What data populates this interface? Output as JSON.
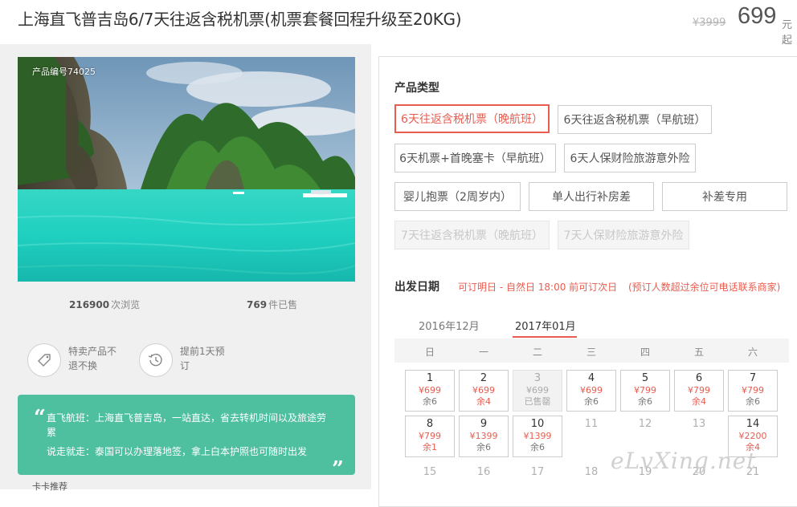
{
  "header": {
    "title": "上海直飞普吉岛6/7天往返含税机票(机票套餐回程升级至20KG)",
    "old_price": "¥3999",
    "price": "699",
    "price_unit": "元起"
  },
  "gallery": {
    "product_code": "产品编号74025"
  },
  "stats": {
    "views_count": "216900",
    "views_label": "次浏览",
    "sold_count": "769",
    "sold_label": "件已售"
  },
  "features": [
    {
      "icon": "tag-icon",
      "text": "特卖产品不退不换"
    },
    {
      "icon": "clock-history-icon",
      "text": "提前1天预订"
    }
  ],
  "notes": {
    "line1": "直飞航班：上海直飞普吉岛，一站直达，省去转机时间以及旅途劳累",
    "line2": "说走就走：泰国可以办理落地签，拿上白本护照也可随时出发"
  },
  "bottom_peek": "卡卡推荐",
  "product_type": {
    "title": "产品类型",
    "options": [
      {
        "label": "6天往返含税机票（晚航班）",
        "state": "selected"
      },
      {
        "label": "6天往返含税机票（早航班）",
        "state": "normal"
      },
      {
        "label": "6天机票+首晚塞卡（早航班）",
        "state": "normal"
      },
      {
        "label": "6天人保财险旅游意外险",
        "state": "normal"
      },
      {
        "label": "婴儿抱票（2周岁内）",
        "state": "normal"
      },
      {
        "label": "单人出行补房差",
        "state": "normal"
      },
      {
        "label": "补差专用",
        "state": "normal"
      },
      {
        "label": "7天往返含税机票（晚航班）",
        "state": "disabled"
      },
      {
        "label": "7天人保财险旅游意外险",
        "state": "disabled"
      }
    ]
  },
  "departure": {
    "title": "出发日期",
    "hint1": "可订明日 - 自然日 18:00 前可订次日",
    "hint2": "(预订人数超过余位可电话联系商家)",
    "months": [
      {
        "label": "2016年12月",
        "active": false
      },
      {
        "label": "2017年01月",
        "active": true
      }
    ],
    "weekdays": [
      "日",
      "一",
      "二",
      "三",
      "四",
      "五",
      "六"
    ],
    "days": [
      {
        "day": "1",
        "price": "¥699",
        "remain": "余6",
        "status": "available"
      },
      {
        "day": "2",
        "price": "¥699",
        "remain": "余4",
        "status": "available",
        "remain_red": true
      },
      {
        "day": "3",
        "price": "¥699",
        "remain": "已售罄",
        "status": "soldout"
      },
      {
        "day": "4",
        "price": "¥699",
        "remain": "余6",
        "status": "available"
      },
      {
        "day": "5",
        "price": "¥799",
        "remain": "余6",
        "status": "available"
      },
      {
        "day": "6",
        "price": "¥799",
        "remain": "余4",
        "status": "available",
        "remain_red": true
      },
      {
        "day": "7",
        "price": "¥799",
        "remain": "余6",
        "status": "available"
      },
      {
        "day": "8",
        "price": "¥799",
        "remain": "余1",
        "status": "available",
        "remain_red": true
      },
      {
        "day": "9",
        "price": "¥1399",
        "remain": "余6",
        "status": "available"
      },
      {
        "day": "10",
        "price": "¥1399",
        "remain": "余6",
        "status": "available"
      },
      {
        "day": "11",
        "status": "none"
      },
      {
        "day": "12",
        "status": "none"
      },
      {
        "day": "13",
        "status": "none"
      },
      {
        "day": "14",
        "price": "¥2200",
        "remain": "余4",
        "status": "available",
        "remain_red": true
      },
      {
        "day": "15",
        "status": "none"
      },
      {
        "day": "16",
        "status": "none"
      },
      {
        "day": "17",
        "status": "none"
      },
      {
        "day": "18",
        "status": "none"
      },
      {
        "day": "19",
        "status": "none"
      },
      {
        "day": "20",
        "status": "none"
      },
      {
        "day": "21",
        "status": "none"
      }
    ]
  },
  "watermark": "eLvXing.net"
}
